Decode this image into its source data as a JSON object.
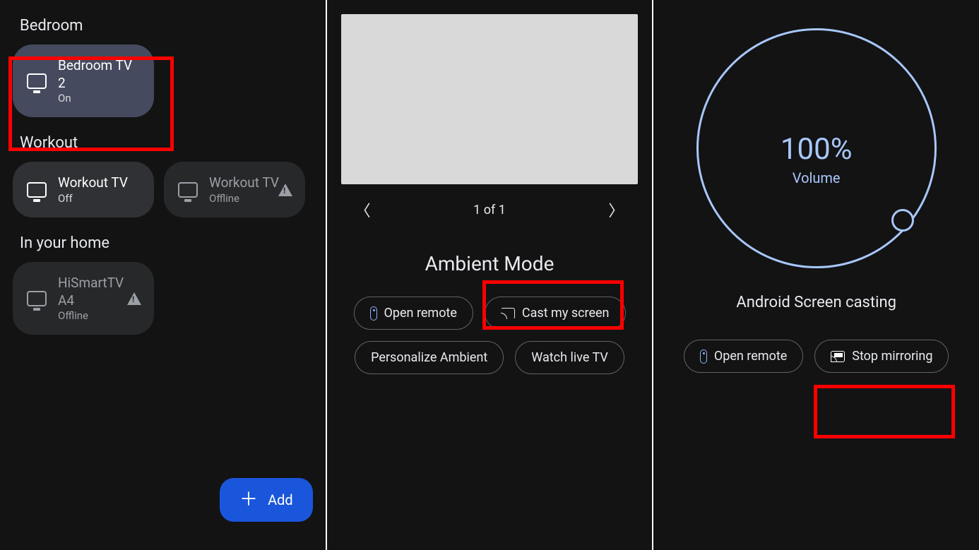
{
  "panel1": {
    "sections": {
      "bedroom": {
        "title": "Bedroom",
        "device": {
          "name": "Bedroom TV 2",
          "status": "On"
        }
      },
      "workout": {
        "title": "Workout",
        "devices": [
          {
            "name": "Workout TV",
            "status": "Off"
          },
          {
            "name": "Workout TV",
            "status": "Offline"
          }
        ]
      },
      "home": {
        "title": "In your home",
        "device": {
          "name": "HiSmartTV A4",
          "status": "Offline"
        }
      }
    },
    "fab": "Add"
  },
  "panel2": {
    "pager": "1 of 1",
    "mode": "Ambient Mode",
    "actions": {
      "open_remote": "Open remote",
      "cast": "Cast my screen",
      "personalize": "Personalize Ambient",
      "watch": "Watch live TV"
    }
  },
  "panel3": {
    "volume": {
      "pct": "100%",
      "label": "Volume"
    },
    "title": "Android Screen casting",
    "actions": {
      "open_remote": "Open remote",
      "stop": "Stop mirroring"
    }
  }
}
